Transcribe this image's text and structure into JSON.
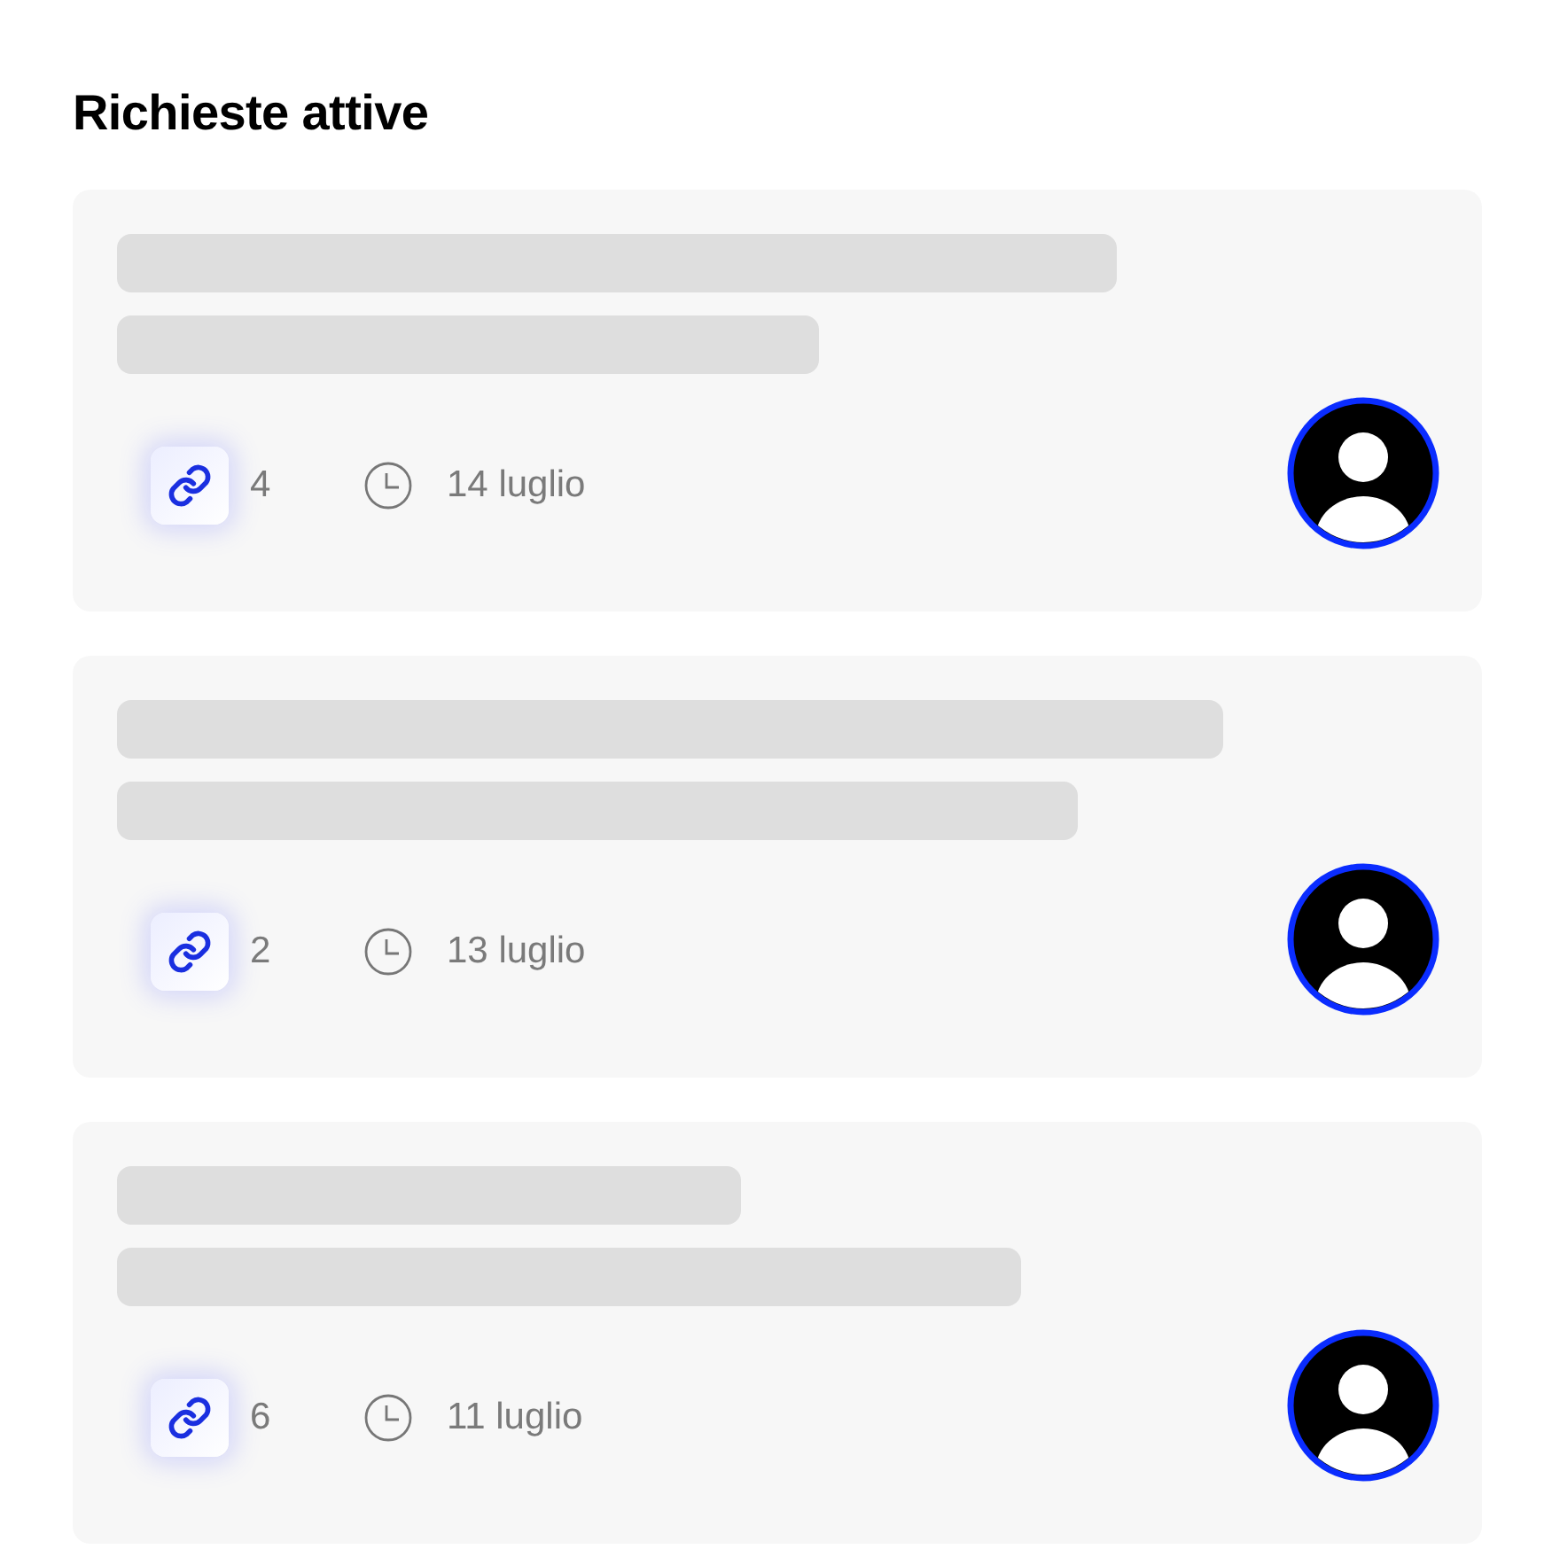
{
  "title": "Richieste attive",
  "requests": [
    {
      "link_count": "4",
      "date": "14 luglio"
    },
    {
      "link_count": "2",
      "date": "13 luglio"
    },
    {
      "link_count": "6",
      "date": "11 luglio"
    }
  ]
}
